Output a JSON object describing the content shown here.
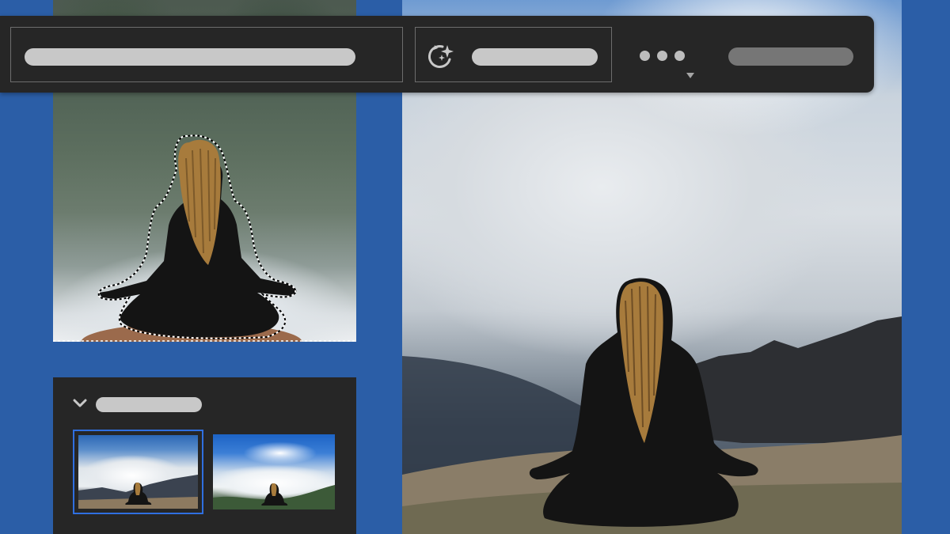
{
  "app": {
    "toolbar": {
      "prompt_placeholder": "",
      "generate_icon": "sparkle-refresh-icon",
      "generate_label": "",
      "more_icon": "ellipsis-icon",
      "secondary_action_label": ""
    },
    "variations": {
      "title": "",
      "collapse_icon": "chevron-down-icon",
      "items": [
        {
          "id": "variation-1",
          "selected": true
        },
        {
          "id": "variation-2",
          "selected": false
        }
      ]
    }
  },
  "colors": {
    "background": "#2b5ea7",
    "toolbar": "#262626",
    "border": "#6d6d6d",
    "placeholder_pill": "#c8c8c8",
    "selection_accent": "#2f6fe0"
  }
}
